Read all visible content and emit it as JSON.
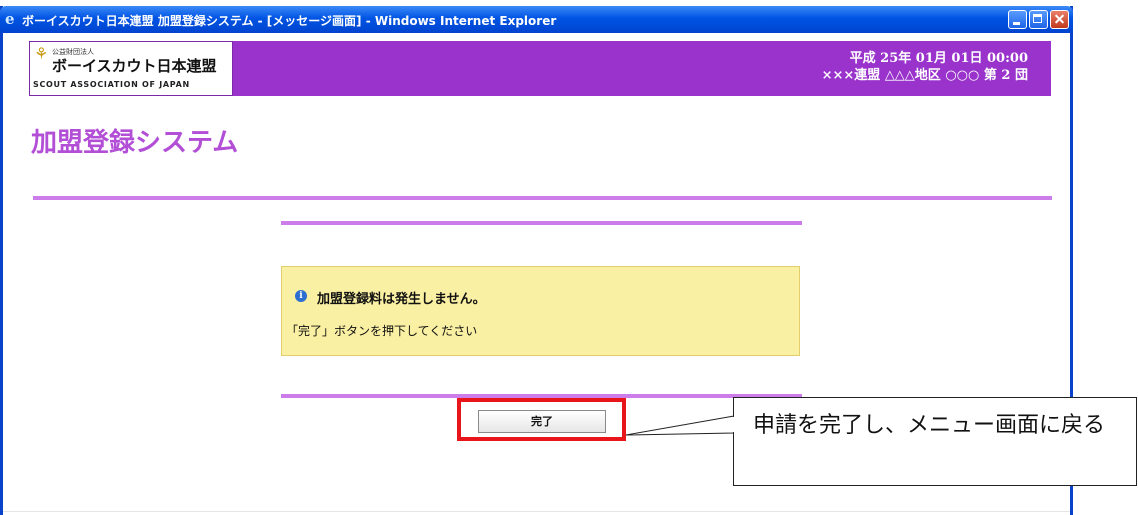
{
  "window": {
    "title": "ボーイスカウト日本連盟 加盟登録システム - [メッセージ画面] - Windows Internet Explorer"
  },
  "header": {
    "logo_small_text": "公益財団法人",
    "logo_main_text": "ボーイスカウト日本連盟",
    "logo_en_text": "SCOUT ASSOCIATION OF JAPAN",
    "date_text": "平成 25年 01月 01日 00:00",
    "org_text": "×××連盟 △△△地区 ○○○ 第 2 団"
  },
  "page": {
    "title": "加盟登録システム"
  },
  "message": {
    "line1": "加盟登録料は発生しません。",
    "line2": "「完了」ボタンを押下してください"
  },
  "actions": {
    "done_label": "完了"
  },
  "annotation": {
    "text": "申請を完了し、メニュー画面に戻る"
  },
  "colors": {
    "header_purple": "#9933cc",
    "title_purple": "#b24fd6",
    "rule_purple": "#cc7de9",
    "message_bg": "#faf0a3",
    "highlight_red": "#e8161b"
  },
  "icons": {
    "browser": "ie-icon",
    "info": "info-icon",
    "emblem": "scout-emblem-icon"
  }
}
